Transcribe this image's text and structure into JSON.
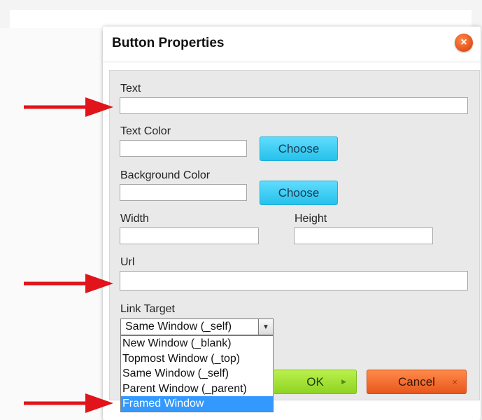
{
  "dialog": {
    "title": "Button Properties",
    "close_glyph": "×"
  },
  "form": {
    "text_label": "Text",
    "text_value": "",
    "text_color_label": "Text Color",
    "text_color_value": "",
    "choose_label": "Choose",
    "background_color_label": "Background Color",
    "background_color_value": "",
    "width_label": "Width",
    "width_value": "",
    "height_label": "Height",
    "height_value": "",
    "url_label": "Url",
    "url_value": "",
    "link_target_label": "Link Target",
    "link_target_value": "Same Window (_self)",
    "link_target_options": [
      "New Window (_blank)",
      "Topmost Window (_top)",
      "Same Window (_self)",
      "Parent Window (_parent)",
      "Framed Window"
    ],
    "highlighted_option": "Framed Window"
  },
  "footer": {
    "ok_label": "OK",
    "cancel_label": "Cancel"
  },
  "colors": {
    "choose_button": "#26c1ea",
    "ok_button": "#8fd321",
    "cancel_button": "#e8571b",
    "close_button": "#e2501a",
    "highlight": "#3399ff",
    "annotation_arrow": "#e0141a"
  },
  "icons": {
    "close": "close-icon",
    "dropdown": "chevron-down-icon",
    "annotation": "red-arrow-icon"
  }
}
